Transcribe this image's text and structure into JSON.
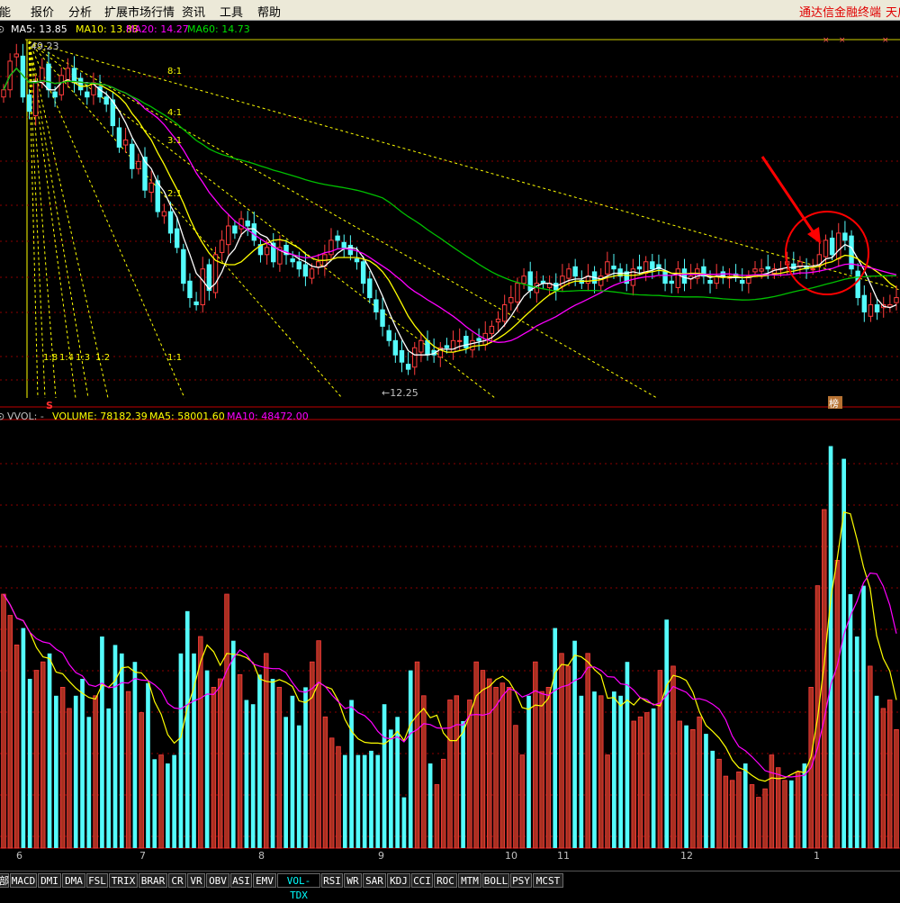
{
  "menu": {
    "items": [
      "功能",
      "报价",
      "分析",
      "扩展市场行情",
      "资讯",
      "工具",
      "帮助"
    ],
    "right_items": [
      "通达信金融终端",
      "天启"
    ]
  },
  "colors": {
    "up": "#ff3c3c",
    "down": "#54fcfc",
    "ma5": "#ffffff",
    "ma10": "#ffff00",
    "ma20": "#ff00ff",
    "ma60": "#00c000",
    "gann": "#ffff00",
    "vol_up_fill": "#a83020",
    "annotation": "#ff0000",
    "grid": "#8b0000"
  },
  "price_panel": {
    "legend": {
      "prefix": "⊙",
      "ma5": "MA5: 13.85",
      "ma10": "MA10: 13.88",
      "ma20": "MA20: 14.27",
      "ma60": "MA60: 14.73"
    },
    "high_label": "49.23",
    "low_label": "←12.25",
    "gann_labels": [
      "8:1",
      "4:1",
      "3:1",
      "2:1",
      "1:1",
      "1:8",
      "1:4",
      "1:3",
      "1:2"
    ],
    "markers": {
      "s": "S",
      "bang": "榜",
      "x1": "×",
      "x2": "×",
      "x3": "×"
    }
  },
  "volume_panel": {
    "legend": {
      "prefix": "⊙",
      "name": "VVOL: -",
      "volume": "VOLUME: 78182.39",
      "ma5": "MA5: 58001.60",
      "ma10": "MA10: 48472.00"
    }
  },
  "time_axis": {
    "labels": [
      "6",
      "7",
      "8",
      "9",
      "10",
      "11",
      "12",
      "1"
    ]
  },
  "indicator_tabs": {
    "items": [
      "部",
      "MACD",
      "DMI",
      "DMA",
      "FSL",
      "TRIX",
      "BRAR",
      "CR",
      "VR",
      "OBV",
      "ASI",
      "EMV",
      "VOL-TDX",
      "RSI",
      "WR",
      "SAR",
      "KDJ",
      "CCI",
      "ROC",
      "MTM",
      "BOLL",
      "PSY",
      "MCST"
    ],
    "active": "VOL-TDX"
  },
  "chart_data": {
    "type": "candlestick",
    "title": "",
    "y_range": [
      12.0,
      16.9
    ],
    "price_range_labels": {
      "high": 49.23,
      "low": 12.25
    },
    "moving_averages": {
      "MA5": 13.85,
      "MA10": 13.88,
      "MA20": 14.27,
      "MA60": 14.73
    },
    "volume": {
      "VOLUME": 78182.39,
      "MA5": 58001.6,
      "MA10": 48472.0
    },
    "months": [
      "6",
      "7",
      "8",
      "9",
      "10",
      "11",
      "12",
      "1"
    ],
    "ohlc_close": [
      16.3,
      16.7,
      16.8,
      16.2,
      16.0,
      16.4,
      16.6,
      16.3,
      16.2,
      16.5,
      16.6,
      16.4,
      16.3,
      16.2,
      16.4,
      16.2,
      16.1,
      15.8,
      15.5,
      15.6,
      15.2,
      15.3,
      14.9,
      15.0,
      14.6,
      14.6,
      14.3,
      14.1,
      13.6,
      13.4,
      13.3,
      13.8,
      13.5,
      14.0,
      14.2,
      14.4,
      14.3,
      14.5,
      14.4,
      14.2,
      14.0,
      14.1,
      13.9,
      14.1,
      14.0,
      13.9,
      13.8,
      13.7,
      13.8,
      13.9,
      14.0,
      14.2,
      14.2,
      14.1,
      14.0,
      13.9,
      13.6,
      13.4,
      13.2,
      13.0,
      12.8,
      12.6,
      12.5,
      12.4,
      12.7,
      12.8,
      12.6,
      12.6,
      12.7,
      12.7,
      12.8,
      12.8,
      12.7,
      12.8,
      12.8,
      12.9,
      13.0,
      13.1,
      13.3,
      13.4,
      13.6,
      13.7,
      13.5,
      13.6,
      13.6,
      13.6,
      13.5,
      13.7,
      13.8,
      13.7,
      13.6,
      13.7,
      13.6,
      13.7,
      13.9,
      13.8,
      13.7,
      13.6,
      13.8,
      13.8,
      13.9,
      13.8,
      13.8,
      13.6,
      13.6,
      13.8,
      13.6,
      13.7,
      13.8,
      13.7,
      13.6,
      13.7,
      13.7,
      13.7,
      13.7,
      13.6,
      13.7,
      13.8,
      13.8,
      13.8,
      13.8,
      13.8,
      13.9,
      13.8,
      13.9,
      13.8,
      13.8,
      14.0,
      14.2,
      14.0,
      14.3,
      14.2,
      13.8,
      13.4,
      13.2,
      13.3,
      13.2,
      13.3,
      13.3,
      13.4
    ],
    "volume_bars": [
      60,
      55,
      48,
      52,
      40,
      42,
      44,
      46,
      36,
      38,
      33,
      36,
      40,
      31,
      36,
      50,
      33,
      48,
      46,
      37,
      44,
      32,
      39,
      21,
      22,
      20,
      22,
      46,
      56,
      46,
      50,
      42,
      38,
      40,
      60,
      49,
      41,
      35,
      34,
      41,
      46,
      40,
      38,
      31,
      36,
      29,
      38,
      44,
      49,
      31,
      26,
      24,
      22,
      35,
      22,
      22,
      23,
      22,
      34,
      28,
      31,
      12,
      42,
      44,
      36,
      20,
      15,
      21,
      35,
      36,
      30,
      35,
      44,
      42,
      40,
      38,
      39,
      38,
      29,
      22,
      36,
      44,
      37,
      38,
      52,
      46,
      43,
      49,
      36,
      46,
      37,
      36,
      22,
      37,
      36,
      44,
      30,
      31,
      32,
      33,
      42,
      54,
      43,
      30,
      29,
      28,
      31,
      27,
      23,
      21,
      17,
      16,
      18,
      20,
      15,
      12,
      14,
      22,
      19,
      16,
      16,
      18,
      20,
      38,
      62,
      80,
      95,
      68,
      92,
      60,
      50,
      62,
      43,
      36,
      33,
      35,
      28
    ]
  }
}
